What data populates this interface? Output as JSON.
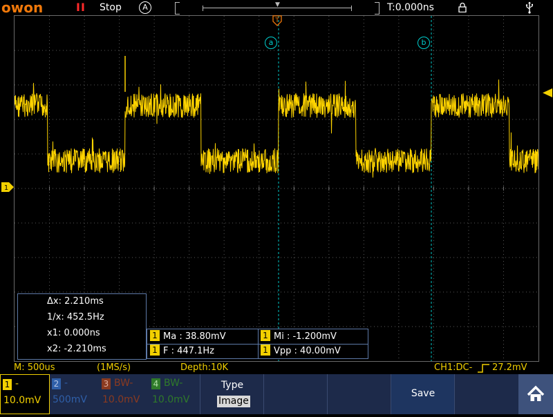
{
  "topbar": {
    "logo": "owon",
    "run_indicator": "II",
    "run_state": "Stop",
    "mode_icon": "A",
    "trigger_time": "T:0.000ns",
    "lock_icon": "lock-icon",
    "usb_icon": "usb-icon",
    "trigger_marker": "T"
  },
  "cursors": {
    "a_label": "a",
    "b_label": "b",
    "panel": {
      "dx": "Δx: 2.210ms",
      "inv_dx": "1/x: 452.5Hz",
      "x1": "x1: 0.000ns",
      "x2": "x2: -2.210ms"
    }
  },
  "channel_marker": "1",
  "measurements": [
    {
      "ch": "1",
      "text": "Ma : 38.80mV"
    },
    {
      "ch": "1",
      "text": "Mi : -1.200mV"
    },
    {
      "ch": "1",
      "text": "F : 447.1Hz"
    },
    {
      "ch": "1",
      "text": "Vpp : 40.00mV"
    }
  ],
  "status": {
    "timebase": "M: 500us",
    "sample_rate": "(1MS/s)",
    "depth": "Depth:10K",
    "trigger": "CH1:DC-",
    "trigger_icon": "rising-edge-icon",
    "trigger_level": "27.2mV"
  },
  "channels": [
    {
      "num": "1",
      "bw": "-",
      "volt": "10.0mV",
      "color": "#f2d000",
      "active": true
    },
    {
      "num": "2",
      "bw": "-",
      "volt": "500mV",
      "color": "#2f5fa8",
      "active": false
    },
    {
      "num": "3",
      "bw": "BW-",
      "volt": "10.0mV",
      "color": "#8a3a20",
      "active": false
    },
    {
      "num": "4",
      "bw": "BW-",
      "volt": "10.0mV",
      "color": "#2f7a2a",
      "active": false
    }
  ],
  "menu": {
    "type_label": "Type",
    "type_value": "Image",
    "save_label": "Save",
    "home_icon": "home-icon"
  },
  "colors": {
    "trace": "#ffd400",
    "cursor": "#00c8c8",
    "accent": "#f0780a",
    "panel_bg": "#1d2a4a"
  }
}
